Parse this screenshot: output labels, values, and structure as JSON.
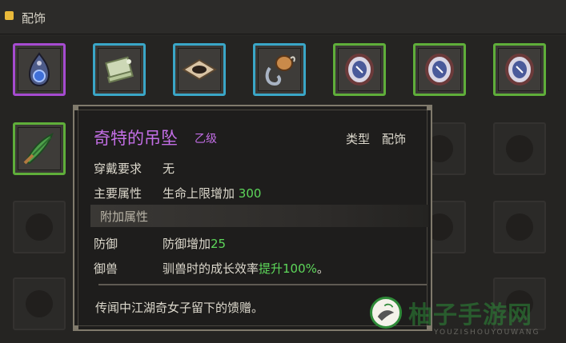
{
  "header": {
    "title": "配饰"
  },
  "tooltip": {
    "item_name": "奇特的吊坠",
    "grade": "乙级",
    "type_label": "类型",
    "type_value": "配饰",
    "requirement_label": "穿戴要求",
    "requirement_value": "无",
    "main_attr_label": "主要属性",
    "main_attr_text": "生命上限增加",
    "main_attr_value": "300",
    "extra_attr_header": "附加属性",
    "extra_attrs": [
      {
        "label": "防御",
        "text": "防御增加",
        "value": "25",
        "suffix": ""
      },
      {
        "label": "御兽",
        "text": "驯兽时的成长效率",
        "value": "提升100%",
        "suffix": "。"
      }
    ],
    "lore": "传闻中江湖奇女子留下的馈赠。"
  },
  "inventory": {
    "slots": [
      {
        "name": "pendant-icon",
        "rarity": "purple"
      },
      {
        "name": "scroll-icon",
        "rarity": "blue"
      },
      {
        "name": "eye-charm-icon",
        "rarity": "blue"
      },
      {
        "name": "hook-gourd-icon",
        "rarity": "blue"
      },
      {
        "name": "shield-charm-icon",
        "rarity": "green"
      },
      {
        "name": "shield-charm-icon",
        "rarity": "green"
      },
      {
        "name": "shield-charm-icon",
        "rarity": "green"
      },
      {
        "name": "herb-bundle-icon",
        "rarity": "green"
      }
    ]
  },
  "colors": {
    "purple": "#a64bd0",
    "blue": "#3aa6c7",
    "green": "#5fae3a",
    "accent_green": "#5dd75a",
    "name_purple": "#c36ee6"
  },
  "watermark": {
    "text": "柚子手游网",
    "sub": "YOUZISHOUYOUWANG"
  }
}
